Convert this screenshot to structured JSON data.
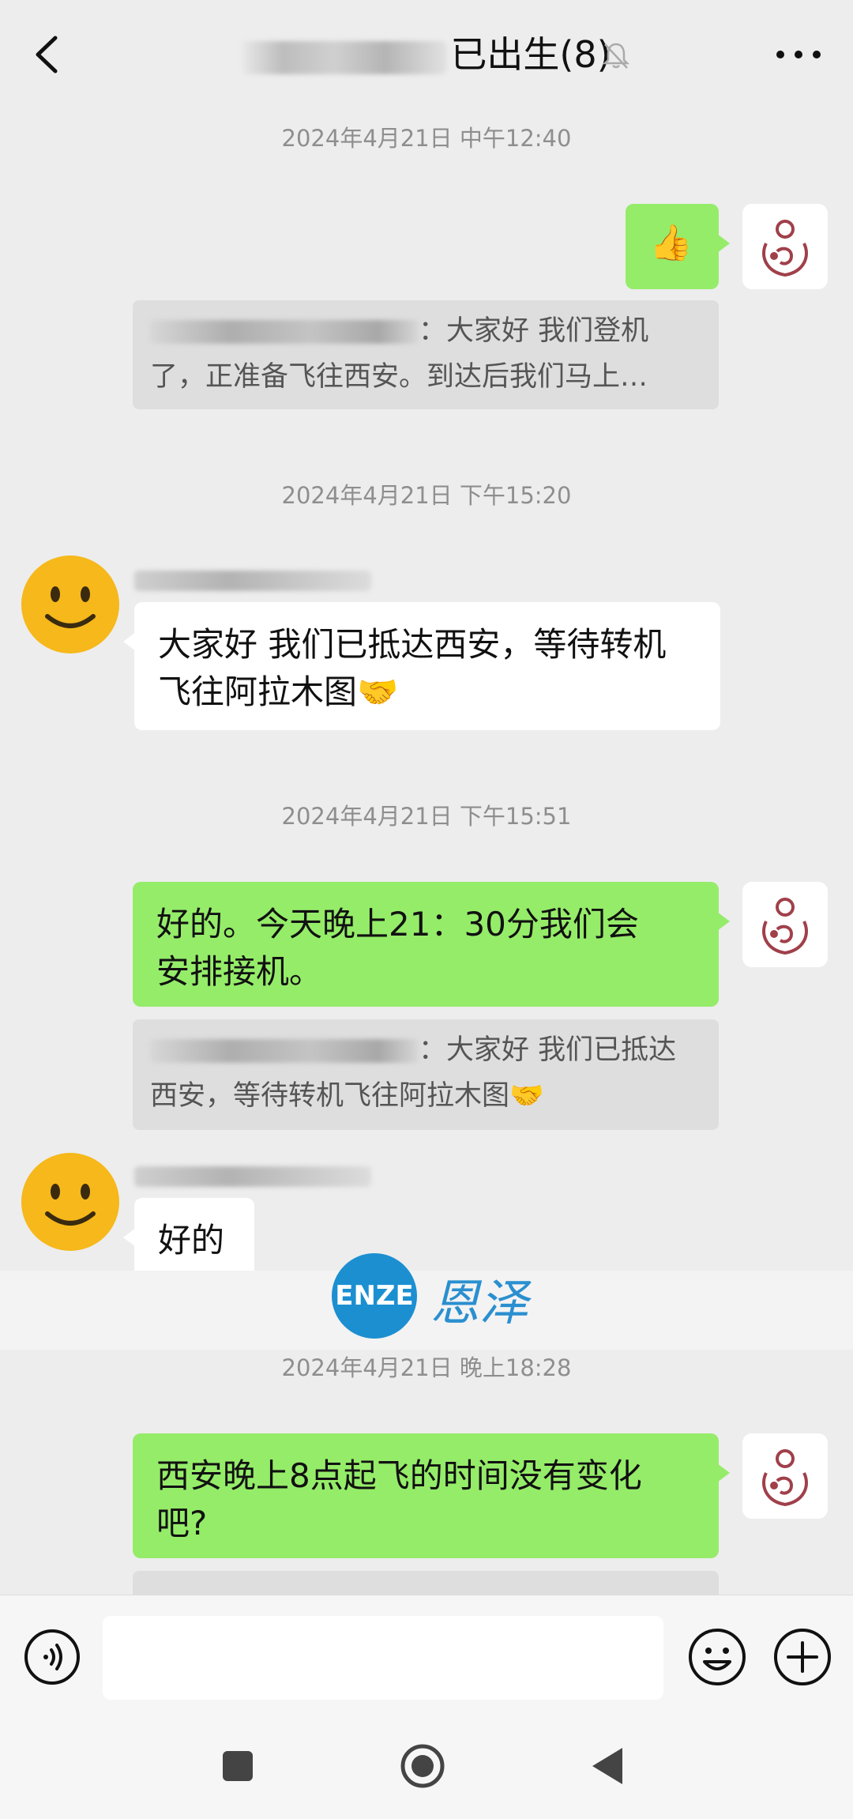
{
  "header": {
    "title_suffix": "已出生(8)",
    "icons": {
      "back": "back-arrow-icon",
      "mute": "mute-bell-icon",
      "more": "more-dots-icon"
    }
  },
  "chat": {
    "timestamps": [
      "2024年4月21日 中午12:40",
      "2024年4月21日 下午15:20",
      "2024年4月21日 下午15:51",
      "2024年4月21日 晚上18:28"
    ],
    "messages": {
      "m1_emoji": "👍",
      "m1_quote_line1": "：大家好 我们登机",
      "m1_quote_line2": "了，正准备飞往西安。到达后我们马上…",
      "m2_line1": "大家好 我们已抵达西安，等待转机",
      "m2_line2": "飞往阿拉木图🤝",
      "m3_line1": "好的。今天晚上21：30分我们会",
      "m3_line2": "安排接机。",
      "m3_quote_line1": "：大家好 我们已抵达",
      "m3_quote_line2": "西安，等待转机飞往阿拉木图🤝",
      "m4": "好的",
      "m5_line1": "西安晚上8点起飞的时间没有变化",
      "m5_line2": "吧?"
    }
  },
  "watermark": {
    "latin": "ENZE",
    "chinese": "恩泽"
  },
  "input_bar": {
    "text_value": "",
    "icons": {
      "voice": "voice-icon",
      "emoji": "emoji-icon",
      "plus": "plus-icon"
    }
  },
  "nav": {
    "icons": [
      "recent-apps-icon",
      "home-icon",
      "back-icon"
    ]
  },
  "colors": {
    "background": "#ededed",
    "green_bubble": "#95ec69",
    "white_bubble": "#ffffff",
    "brand_avatar": "#a0404a",
    "watermark": "#1c8fd1"
  }
}
